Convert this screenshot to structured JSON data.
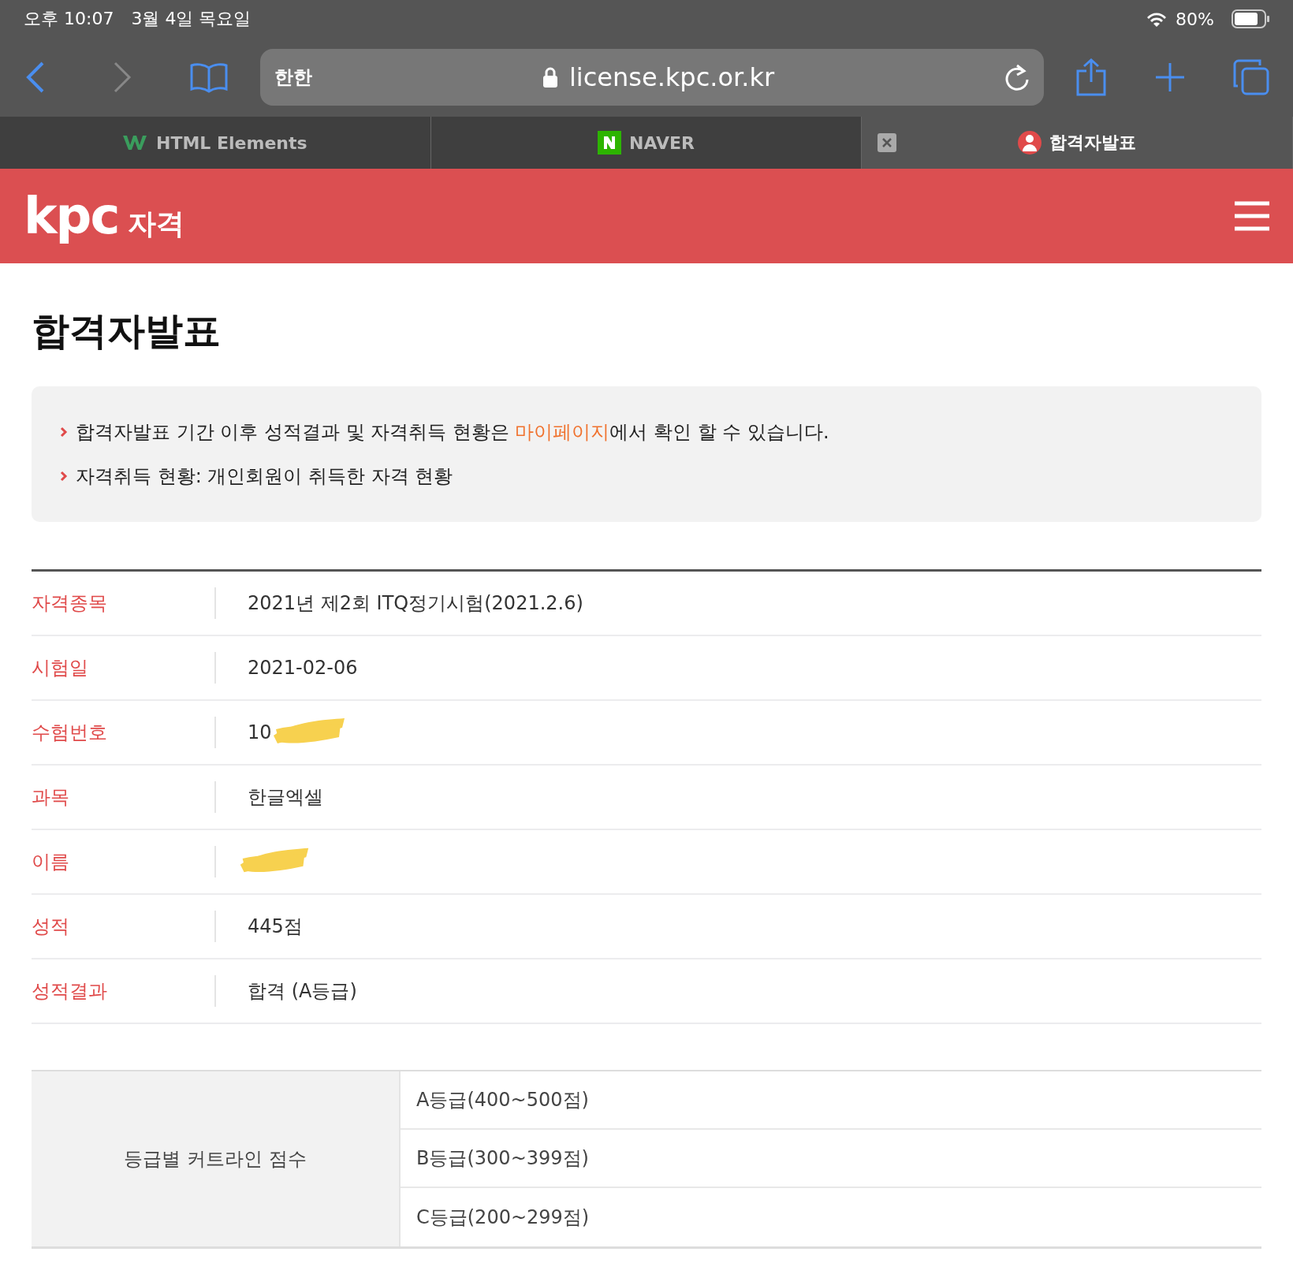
{
  "status_bar": {
    "time": "오후 10:07",
    "date": "3월 4일 목요일",
    "battery": "80%"
  },
  "toolbar": {
    "address": "license.kpc.or.kr",
    "reader_label": "한한"
  },
  "tabs": [
    {
      "label": "HTML Elements",
      "kind": "w3",
      "selected": false
    },
    {
      "label": "NAVER",
      "kind": "naver",
      "selected": false
    },
    {
      "label": "합격자발표",
      "kind": "person",
      "selected": true
    }
  ],
  "site_header": {
    "logo_mark": "kpc",
    "logo_text": "자격"
  },
  "page_title": "합격자발표",
  "notices": [
    {
      "kind": "with_link",
      "before": "합격자발표 기간 이후 성적결과 및 자격취득 현황은 ",
      "link": "마이페이지",
      "after": "에서 확인 할 수 있습니다."
    },
    {
      "kind": "plain",
      "text": "자격취득 현황: 개인회원이 취득한 자격 현황"
    }
  ],
  "result_rows": [
    {
      "label": "자격종목",
      "value": "2021년 제2회 ITQ정기시험(2021.2.6)",
      "redacted": false
    },
    {
      "label": "시험일",
      "value": "2021-02-06",
      "redacted": false
    },
    {
      "label": "수험번호",
      "value": "10",
      "redacted": true
    },
    {
      "label": "과목",
      "value": "한글엑셀",
      "redacted": false
    },
    {
      "label": "이름",
      "redacted": true
    },
    {
      "label": "성적",
      "value": "445점",
      "redacted": false
    },
    {
      "label": "성적결과",
      "value": "합격 (A등급)",
      "redacted": false
    }
  ],
  "cutline_table": {
    "heading": "등급별 커트라인 점수",
    "grades": [
      "A등급(400~500점)",
      "B등급(300~399점)",
      "C등급(200~299점)"
    ]
  }
}
